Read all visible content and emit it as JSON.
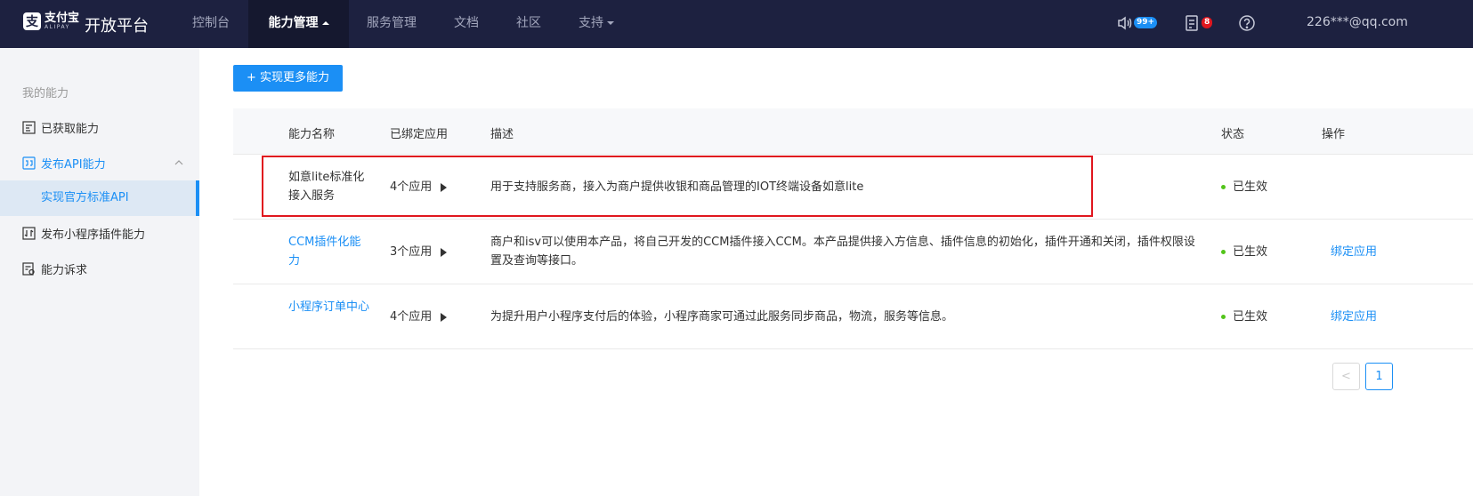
{
  "header": {
    "logo_cn": "支付宝",
    "logo_en": "ALIPAY",
    "platform": "开放平台",
    "nav": [
      {
        "label": "控制台"
      },
      {
        "label": "能力管理"
      },
      {
        "label": "服务管理"
      },
      {
        "label": "文档"
      },
      {
        "label": "社区"
      },
      {
        "label": "支持"
      }
    ],
    "active_nav": "能力管理",
    "notice_badge": "99+",
    "todo_badge": "8",
    "help_icon": "question-icon",
    "user_email": "226***@qq.com"
  },
  "sidebar": {
    "title": "我的能力",
    "items": [
      {
        "label": "已获取能力",
        "icon": "capability-list-icon"
      },
      {
        "label": "发布API能力",
        "icon": "api-icon"
      },
      {
        "label": "发布小程序插件能力",
        "icon": "plugin-icon"
      },
      {
        "label": "能力诉求",
        "icon": "request-icon"
      }
    ],
    "sub_item": "实现官方标准API"
  },
  "main": {
    "add_button": "+ 实现更多能力",
    "columns": [
      "能力名称",
      "已绑定应用",
      "描述",
      "状态",
      "操作"
    ],
    "rows": [
      {
        "name": "如意lite标准化接入服务",
        "apps": "4个应用",
        "desc": "用于支持服务商，接入为商户提供收银和商品管理的IOT终端设备如意lite",
        "status": "已生效",
        "op": ""
      },
      {
        "name": "CCM插件化能力",
        "apps": "3个应用",
        "desc": "商户和isv可以使用本产品，将自己开发的CCM插件接入CCM。本产品提供接入方信息、插件信息的初始化，插件开通和关闭，插件权限设置及查询等接口。",
        "status": "已生效",
        "op": "绑定应用"
      },
      {
        "name": "小程序订单中心",
        "apps": "4个应用",
        "desc": "为提升用户小程序支付后的体验，小程序商家可通过此服务同步商品，物流，服务等信息。",
        "status": "已生效",
        "op": "绑定应用"
      }
    ],
    "pagination": {
      "prev": "<",
      "current": "1"
    }
  },
  "colors": {
    "topbar": "#1d2140",
    "accent": "#1b8ff5",
    "highlight": "#e0161e",
    "status_ok": "#52c41a"
  }
}
